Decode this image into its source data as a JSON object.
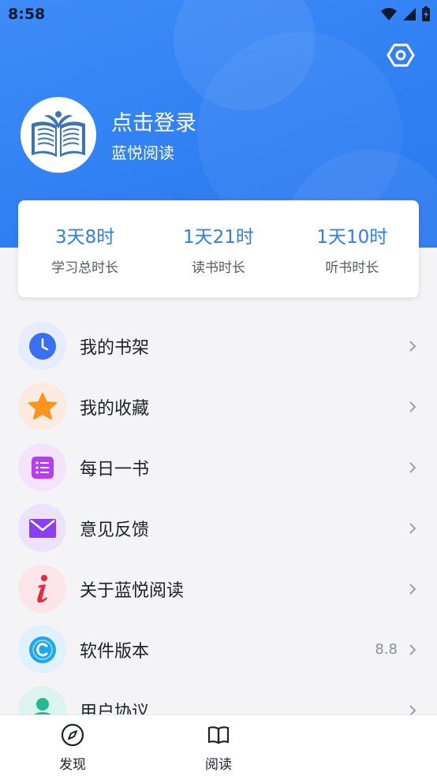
{
  "status_bar": {
    "time": "8:58"
  },
  "header": {
    "login_title": "点击登录",
    "app_name": "蓝悦阅读",
    "settings_icon": "settings-hexagon-icon",
    "avatar_icon": "open-book-logo"
  },
  "stats": [
    {
      "value": "3天8时",
      "label": "学习总时长"
    },
    {
      "value": "1天21时",
      "label": "读书时长"
    },
    {
      "value": "1天10时",
      "label": "听书时长"
    }
  ],
  "menu": [
    {
      "label": "我的书架",
      "icon": "clock-icon",
      "bg": "#e6ecfb",
      "color": "#3a6ff0"
    },
    {
      "label": "我的收藏",
      "icon": "star-icon",
      "bg": "#fbeadf",
      "color": "#f8951e"
    },
    {
      "label": "每日一书",
      "icon": "list-icon",
      "bg": "#f3e3fb",
      "color": "#b53ff0"
    },
    {
      "label": "意见反馈",
      "icon": "mail-icon",
      "bg": "#ece3fb",
      "color": "#8c3ff0"
    },
    {
      "label": "关于蓝悦阅读",
      "icon": "info-icon",
      "bg": "#fbe5e8",
      "color": "#e8283c"
    },
    {
      "label": "软件版本",
      "icon": "copyright-icon",
      "bg": "#dff1fb",
      "color": "#1ea7ec",
      "extra": "8.8"
    },
    {
      "label": "用户协议",
      "icon": "user-icon",
      "bg": "#dcf4ee",
      "color": "#22b893"
    }
  ],
  "tabbar": [
    {
      "label": "发现",
      "icon": "compass-icon"
    },
    {
      "label": "阅读",
      "icon": "book-icon"
    }
  ],
  "colors": {
    "primary": "#2f7ff3",
    "stat_value": "#2f7fe6"
  }
}
